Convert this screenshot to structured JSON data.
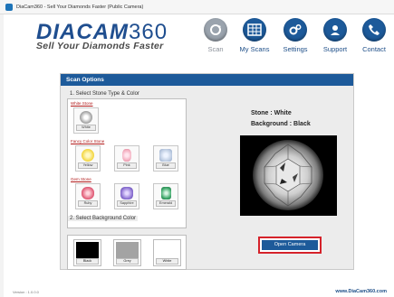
{
  "window": {
    "title": "DiaCam360 - Sell Your Diamonds Faster (Public Camera)"
  },
  "logo": {
    "brand": "DIACAM",
    "number": "360",
    "tagline": "Sell Your Diamonds Faster"
  },
  "nav": [
    {
      "label": "Scan",
      "icon": "scan-icon",
      "active": false
    },
    {
      "label": "My Scans",
      "icon": "calendar-grid-icon",
      "active": true
    },
    {
      "label": "Settings",
      "icon": "gears-icon",
      "active": true
    },
    {
      "label": "Support",
      "icon": "support-person-icon",
      "active": true
    },
    {
      "label": "Contact",
      "icon": "phone-icon",
      "active": true
    }
  ],
  "panel": {
    "title": "Scan Options",
    "section1": "1. Select Stone Type & Color",
    "section2": "2. Select Background Color",
    "white_group": "White Stone",
    "fancy_group": "Fancy Color Stone",
    "gem_group": "Gem Stone",
    "white_stones": [
      {
        "caption": "White"
      }
    ],
    "fancy_stones": [
      {
        "caption": "Yellow"
      },
      {
        "caption": "Pink"
      },
      {
        "caption": "Blue"
      }
    ],
    "gem_stones": [
      {
        "caption": "Ruby"
      },
      {
        "caption": "Sapphire"
      },
      {
        "caption": "Emerald"
      }
    ],
    "backgrounds": [
      {
        "caption": "Black"
      },
      {
        "caption": "Grey"
      },
      {
        "caption": "White"
      }
    ]
  },
  "preview": {
    "stone_label": "Stone : White",
    "background_label": "Background : Black"
  },
  "actions": {
    "open_camera": "Open Camera"
  },
  "footer": {
    "version": "Version : 1.0.0.0",
    "website": "www.DiaCam360.com"
  },
  "colors": {
    "accent": "#1d5a9a",
    "highlight": "#d5222a"
  }
}
